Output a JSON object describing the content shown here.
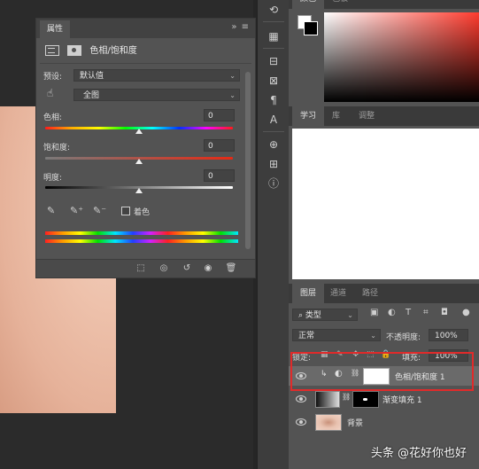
{
  "properties_panel": {
    "tab_label": "属性",
    "menu_glyph": "»  ≡",
    "adjustment_title": "色相/饱和度",
    "preset_label": "预设:",
    "preset_value": "默认值",
    "channel_value": "全图",
    "hue_label": "色相:",
    "hue_value": "0",
    "saturation_label": "饱和度:",
    "saturation_value": "0",
    "lightness_label": "明度:",
    "lightness_value": "0",
    "colorize_label": "着色",
    "colorize_checked": false,
    "hue_slider_position": 0.5,
    "saturation_slider_position": 0.5,
    "lightness_slider_position": 0.5
  },
  "right_top_tabs": [
    "颜色",
    "色板"
  ],
  "learn_tabs": [
    "学习",
    "库",
    "调整"
  ],
  "layers_panel": {
    "tabs": [
      "图层",
      "通道",
      "路径"
    ],
    "filter_value": "类型",
    "blend_mode": "正常",
    "opacity_label": "不透明度:",
    "opacity_value": "100%",
    "lock_label": "锁定:",
    "fill_label": "填充:",
    "fill_value": "100%",
    "layers": [
      {
        "name": "色相/饱和度 1",
        "selected": true
      },
      {
        "name": "渐变填充 1",
        "selected": false
      },
      {
        "name": "背景",
        "selected": false
      }
    ]
  },
  "toolstrip_top_label": "",
  "watermark": "头条 @花好你也好",
  "colors": {
    "highlight_box": "#e12a2a",
    "panel_bg": "#535353"
  }
}
